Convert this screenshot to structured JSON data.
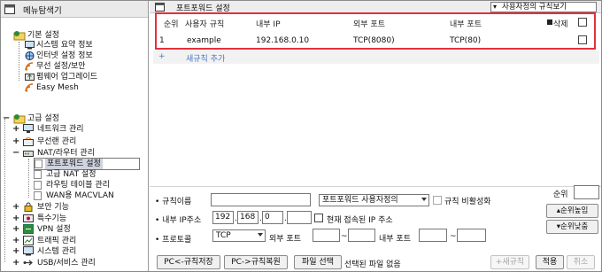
{
  "sidebar": {
    "title": "메뉴탐색기",
    "basic": {
      "label": "기본 설정",
      "items": [
        "시스템 요약 정보",
        "인터넷 설정 정보",
        "무선 설정/보안",
        "펌웨어 업그레이드",
        "Easy Mesh"
      ]
    },
    "advanced": {
      "label": "고급 설정",
      "network": "네트워크 관리",
      "wireless": "무선랜 관리",
      "nat": {
        "label": "NAT/라우터 관리",
        "children": [
          "포트포워드 설정",
          "고급 NAT 설정",
          "라우팅 테이블 관리",
          "WAN용 MACVLAN"
        ]
      },
      "rest": [
        "보안 기능",
        "특수기능",
        "VPN 설정",
        "트래픽 관리",
        "시스템 관리",
        "USB/서비스 관리"
      ]
    },
    "selected_item": "포트포워드 설정"
  },
  "main": {
    "title": "포트포워드 설정",
    "rule_view": "사용자정의 규칙보기",
    "table": {
      "headers": [
        "순위",
        "사용자 규칙",
        "내부 IP",
        "외부 포트",
        "내부 포트",
        "삭제"
      ],
      "rows": [
        {
          "rank": "1",
          "rule": "example",
          "ip": "192.168.0.10",
          "ext": "TCP(8080)",
          "int": "TCP(80)"
        }
      ]
    },
    "add_row": {
      "plus": "+",
      "label": "새규칙 추가"
    }
  },
  "form": {
    "rule_name_label": "규칙이름",
    "rule_type": "포트포워드 사용자정의",
    "disable_label": "규칙 비활성화",
    "ip_label": "내부 IP주소",
    "ip": [
      "192",
      "168",
      "0",
      ""
    ],
    "current_ip_label": "현재 접속된 IP 주소",
    "protocol_label": "프로토콜",
    "protocol": "TCP",
    "ext_port_label": "외부 포트",
    "int_port_label": "내부 포트",
    "tilde": "~",
    "rank_label": "순위",
    "rank_up": "순위높임",
    "rank_down": "순위낮춤",
    "pc_save": "PC<-규칙저장",
    "pc_restore": "PC->규칙복원",
    "file_select": "파일 선택",
    "no_file": "선택된 파일 없음",
    "new_rule": "새규칙",
    "apply": "적용",
    "cancel": "취소"
  },
  "colors": {
    "highlight": "#e5303a",
    "link": "#4a78c8",
    "selected": "#cfd3df"
  }
}
